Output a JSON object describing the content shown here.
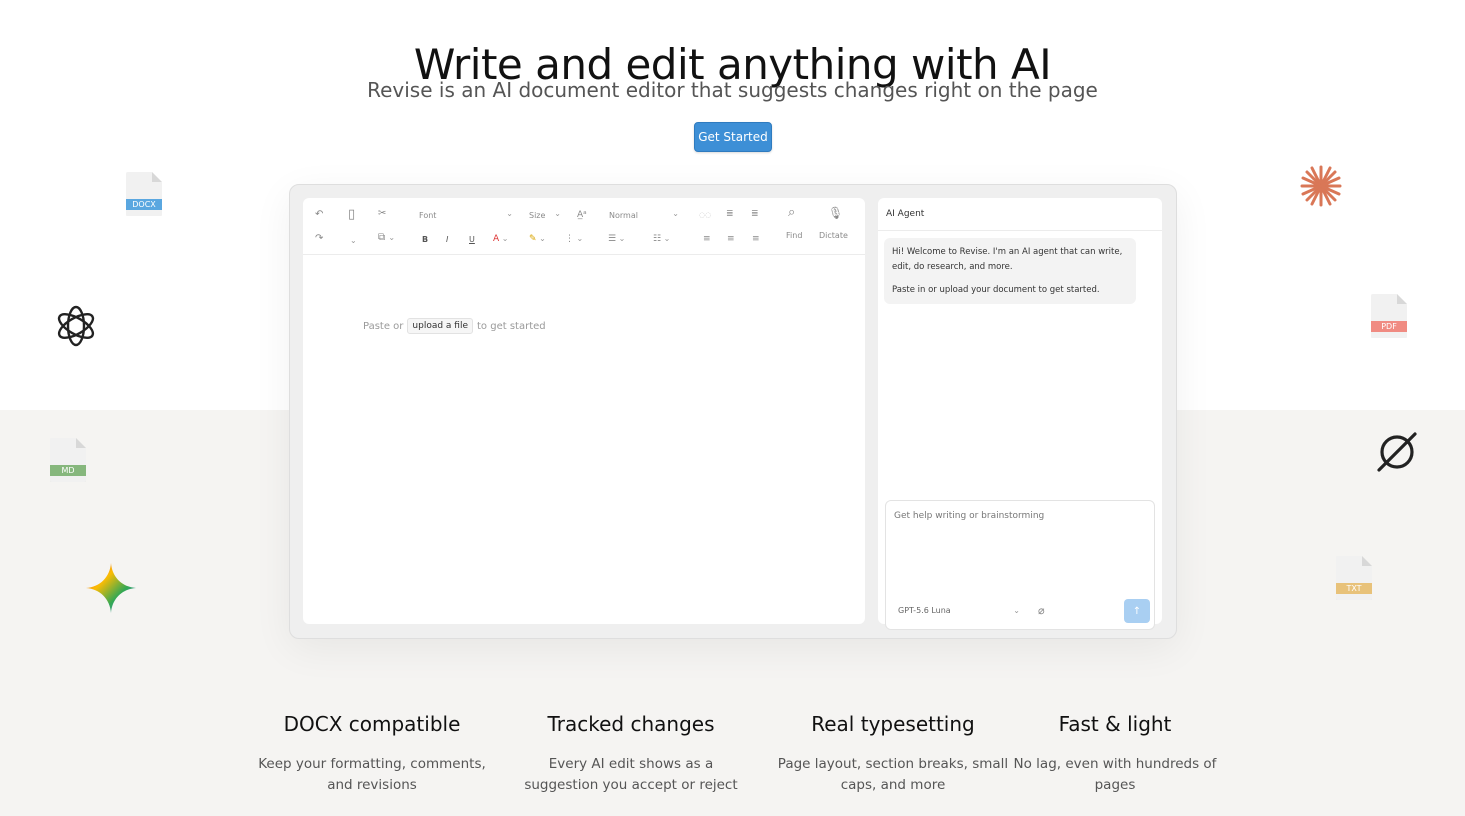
{
  "hero": {
    "title": "Write and edit anything with AI",
    "subtitle": "Revise is an AI document editor that suggests changes right on the page",
    "cta_label": "Get Started"
  },
  "floating_icons": {
    "docx": "DOCX",
    "pdf": "PDF",
    "md": "MD",
    "txt": "TXT",
    "colors": {
      "docx": "#5aa7e0",
      "pdf": "#f08b82",
      "md": "#86b77d",
      "txt": "#e8c27a"
    },
    "brands": [
      "openai-icon",
      "claude-asterisk-icon",
      "perplexity-icon",
      "gemini-star-icon"
    ]
  },
  "editor": {
    "toolbar": {
      "font_placeholder": "Font",
      "size_placeholder": "Size",
      "style_value": "Normal",
      "find_label": "Find",
      "dictate_label": "Dictate"
    },
    "placeholder_before": "Paste or",
    "upload_label": "upload a file",
    "placeholder_after": "to get started"
  },
  "agent": {
    "title": "AI Agent",
    "welcome_line1": "Hi! Welcome to Revise. I'm an AI agent that can write, edit, do research, and more.",
    "welcome_line2": "Paste in or upload your document to get started.",
    "input_placeholder": "Get help writing or brainstorming",
    "model": "GPT-5.6 Luna"
  },
  "features": [
    {
      "title": "DOCX compatible",
      "desc": "Keep your formatting, comments, and revisions"
    },
    {
      "title": "Tracked changes",
      "desc": "Every AI edit shows as a suggestion you accept or reject"
    },
    {
      "title": "Real typesetting",
      "desc": "Page layout, section breaks, small caps, and more"
    },
    {
      "title": "Fast & light",
      "desc": "No lag, even with hundreds of pages"
    }
  ],
  "colors": {
    "accent": "#3d8fd6",
    "send_disabled": "#a9cff2"
  }
}
